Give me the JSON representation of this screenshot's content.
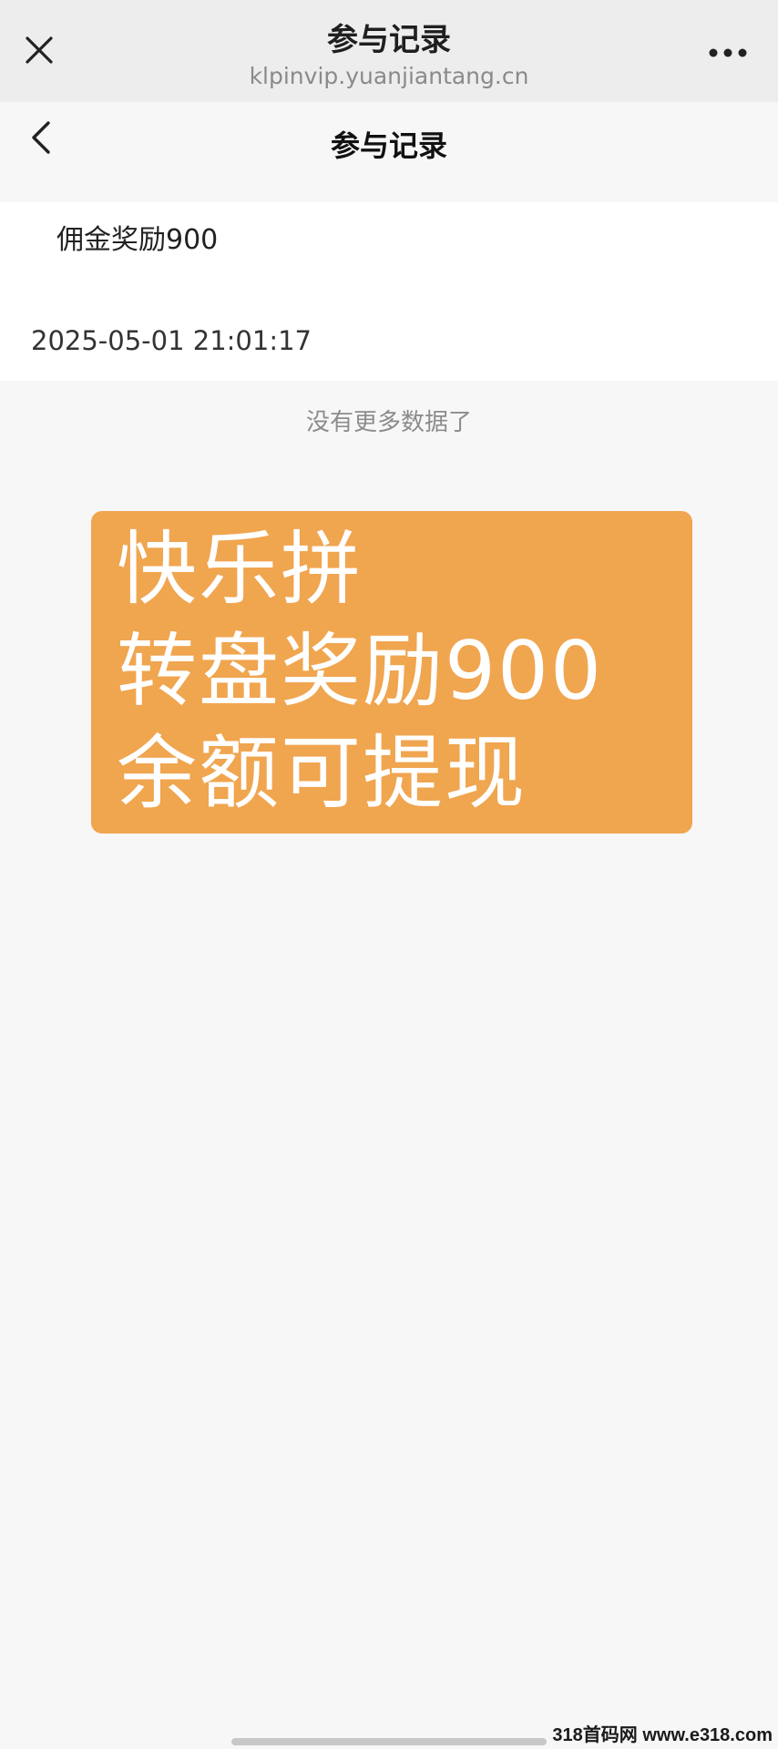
{
  "browser": {
    "title": "参与记录",
    "url": "klpinvip.yuanjiantang.cn",
    "close_icon": "close-icon",
    "more_icon": "more-horizontal-icon"
  },
  "page": {
    "title": "参与记录",
    "back_icon": "chevron-left-icon"
  },
  "records": [
    {
      "title": "佣金奖励900",
      "time": "2025-05-01 21:01:17"
    }
  ],
  "status": {
    "no_more": "没有更多数据了"
  },
  "promo": {
    "line1": "快乐拼",
    "line2": "转盘奖励900",
    "line3": "余额可提现",
    "background": "#f0a54f"
  },
  "watermark": {
    "text": "318首码网 www.e318.com"
  }
}
